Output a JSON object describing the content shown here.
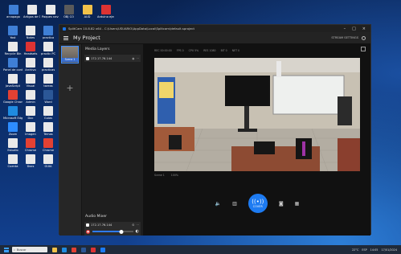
{
  "desktop": {
    "top_icons": [
      {
        "label": "arcapago",
        "color": "#3f7fd6"
      },
      {
        "label": "Artigos de GUSA CO",
        "color": "#e9e9e9"
      },
      {
        "label": "Paques navegate",
        "color": "#e9e9e9"
      },
      {
        "label": "OBJ CO",
        "color": "#5a5a5a"
      },
      {
        "label": "AUD",
        "color": "#f2c24a"
      },
      {
        "label": "Arduino ejecu.v",
        "color": "#d33"
      }
    ],
    "col1": [
      {
        "label": "Yost",
        "color": "#3f7fd6"
      },
      {
        "label": "Recycle Bin",
        "color": "#e9e9e9"
      },
      {
        "label": "Panel de control",
        "color": "#3f7fd6"
      },
      {
        "label": "JavaScript",
        "color": "#e9e9e9"
      },
      {
        "label": "Google Chrome",
        "color": "#e34133"
      },
      {
        "label": "Microsoft Edge",
        "color": "#1f8be0"
      },
      {
        "label": "Zoom",
        "color": "#2d8cff"
      },
      {
        "label": "Estudio",
        "color": "#e9e9e9"
      },
      {
        "label": "Cuenta",
        "color": "#e9e9e9"
      }
    ],
    "col2": [
      {
        "label": "Notes",
        "color": "#e9e9e9"
      },
      {
        "label": "Headsets",
        "color": "#d33"
      },
      {
        "label": "Archivo",
        "color": "#e9e9e9"
      },
      {
        "label": "Visual",
        "color": "#e9e9e9"
      },
      {
        "label": "Admin",
        "color": "#e9e9e9"
      },
      {
        "label": "Doc",
        "color": "#e9e9e9"
      },
      {
        "label": "Imagen",
        "color": "#e9e9e9"
      },
      {
        "label": "Chrome",
        "color": "#e34133"
      },
      {
        "label": "Docs",
        "color": "#e9e9e9"
      }
    ],
    "col3": [
      {
        "label": "practica",
        "color": "#3f7fd6"
      },
      {
        "label": "practic PC",
        "color": "#e9e9e9"
      },
      {
        "label": "practicas",
        "color": "#e9e9e9"
      },
      {
        "label": "tareas",
        "color": "#e9e9e9"
      },
      {
        "label": "Word",
        "color": "#2b5797"
      },
      {
        "label": "Guias",
        "color": "#e9e9e9"
      },
      {
        "label": "Temas",
        "color": "#e9e9e9"
      },
      {
        "label": "Chrome",
        "color": "#e34133"
      },
      {
        "label": "GUIA",
        "color": "#e9e9e9"
      }
    ]
  },
  "window": {
    "title": "SplitCam 10.8.82 x64 - C:\\Users\\USUARIO\\AppData\\Local\\Splitcam\\default.sproject",
    "project_title": "My Project",
    "menu_right": "STREAM SETTINGS",
    "controls": {
      "minimize": "–",
      "maximize": "□",
      "close": "×"
    }
  },
  "scenes": {
    "thumb_label": "Scene 1",
    "add_label": "+"
  },
  "layers": {
    "header": "Media Layers",
    "items": [
      {
        "name": "172.17.76.144"
      }
    ]
  },
  "mixer": {
    "header": "Audio Mixer",
    "items": [
      {
        "name": "172.17.76.144",
        "volume": 0.72
      }
    ]
  },
  "preview": {
    "track_labels": [
      "REC 00:00:00",
      "FPS 0",
      "CPU 5%",
      "RES 1080",
      "BIT 0",
      "NET 0"
    ],
    "status_left": "Scene 1",
    "status_right": "100%",
    "cover_label": "COVER",
    "icons": [
      "volume-icon",
      "grid-icon",
      "cover-button",
      "camera-icon",
      "settings-icon"
    ]
  },
  "taskbar": {
    "search_placeholder": "Buscar",
    "tray_text": "ESP",
    "time": "14:05",
    "date": "17/01/2024",
    "weather": "22°C"
  },
  "colors": {
    "accent": "#1d7bf2",
    "danger": "#e23d3d",
    "window_bg": "#1b1b1b"
  }
}
